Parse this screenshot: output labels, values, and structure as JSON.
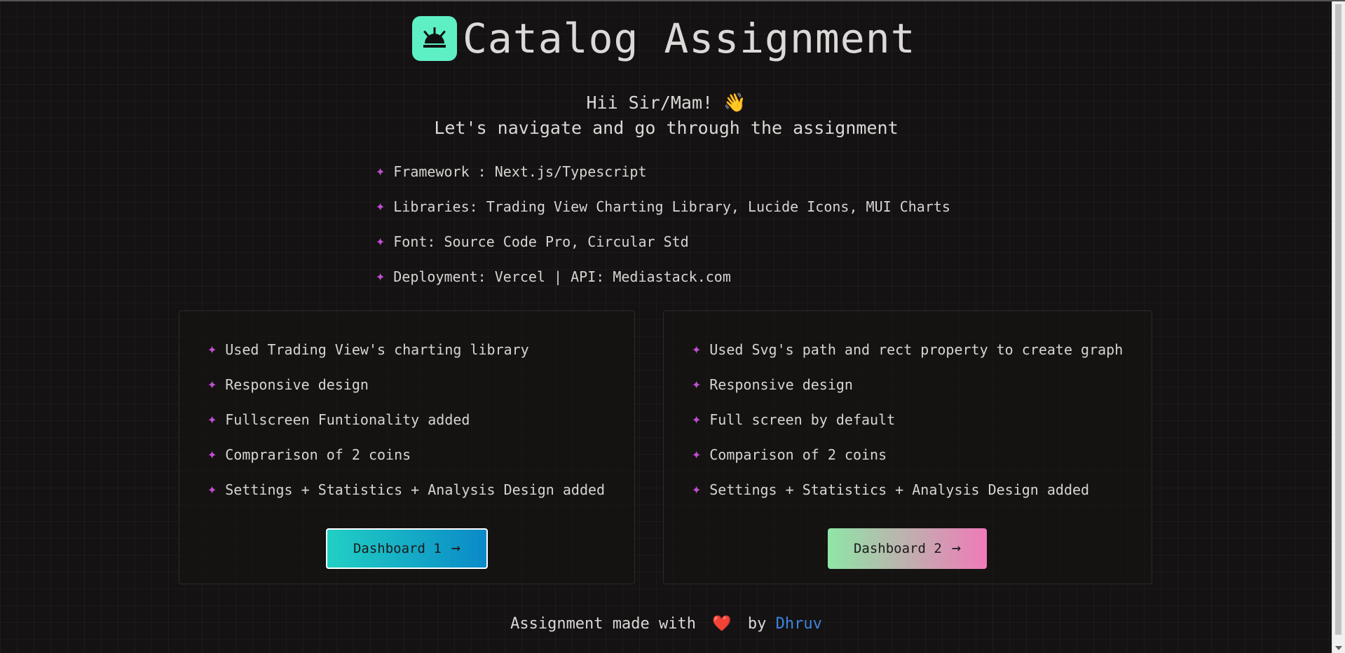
{
  "header": {
    "title": "Catalog Assignment",
    "logo_icon": "sunrise-icon",
    "logo_color": "#5ef0c4"
  },
  "intro": {
    "greeting": "Hii Sir/Mam!",
    "greeting_emoji": "👋",
    "subtitle": "Let's navigate and go through the assignment"
  },
  "info": {
    "items": [
      "Framework : Next.js/Typescript",
      "Libraries: Trading View Charting Library, Lucide Icons, MUI Charts",
      "Font: Source Code Pro, Circular Std",
      "Deployment: Vercel | API: Mediastack.com"
    ]
  },
  "cards": [
    {
      "items": [
        "Used Trading View's charting library",
        "Responsive design",
        "Fullscreen Funtionality added",
        "Comprarison of 2 coins",
        "Settings + Statistics + Analysis Design added"
      ],
      "button_label": "Dashboard 1"
    },
    {
      "items": [
        "Used Svg's path and rect property to create graph",
        "Responsive design",
        "Full screen by default",
        "Comparison of 2 coins",
        "Settings + Statistics + Analysis Design added"
      ],
      "button_label": "Dashboard 2"
    }
  ],
  "footer": {
    "prefix": "Assignment made with",
    "heart": "❤️",
    "by": "by",
    "author": "Dhruv"
  },
  "colors": {
    "background": "#151213",
    "bullet": "#c04fd0",
    "author_link": "#3d86e0",
    "button1_gradient": [
      "#21d0c3",
      "#0a89c8"
    ],
    "button2_gradient": [
      "#8ee6a6",
      "#f07ab8"
    ]
  }
}
